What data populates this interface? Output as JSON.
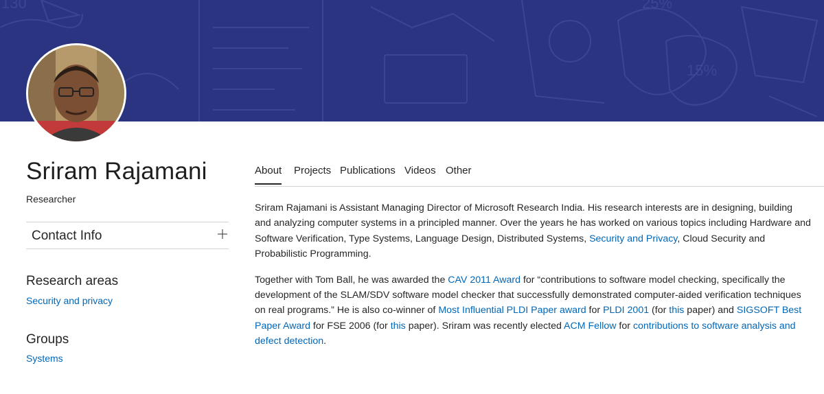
{
  "profile": {
    "name": "Sriram Rajamani",
    "role": "Researcher"
  },
  "contact": {
    "label": "Contact Info",
    "expand_icon": "plus-icon"
  },
  "research_areas": {
    "heading": "Research areas",
    "items": [
      "Security and privacy"
    ]
  },
  "groups": {
    "heading": "Groups",
    "items": [
      "Systems"
    ]
  },
  "tabs": [
    {
      "label": "About",
      "active": true
    },
    {
      "label": "Projects",
      "active": false
    },
    {
      "label": "Publications",
      "active": false
    },
    {
      "label": "Videos",
      "active": false
    },
    {
      "label": "Other",
      "active": false
    }
  ],
  "about": {
    "p1": {
      "t1": "Sriram Rajamani is Assistant Managing Director of Microsoft Research India. His research interests are in designing, building and analyzing computer systems in a principled manner. Over the years he has worked on various topics including Hardware and Software Verification, Type Systems, Language Design, Distributed Systems, ",
      "link1": "Security and Privacy",
      "t2": ", Cloud Security and Probabilistic Programming."
    },
    "p2": {
      "t1": "Together with Tom Ball, he was awarded the ",
      "link1": "CAV 2011 Award",
      "t2": " for “contributions to software model checking, specifically the development of the SLAM/SDV software model checker that successfully demonstrated computer-aided verification techniques on real programs.”  He is also co-winner of ",
      "link2": "Most Influential PLDI Paper award",
      "t3": " for ",
      "link3": "PLDI 2001",
      "t4": " (for ",
      "link4": "this",
      "t5": " paper) and ",
      "link5": "SIGSOFT Best Paper Award",
      "t6": " for FSE 2006 (for ",
      "link6": "this",
      "t7": " paper).  Sriram was recently elected ",
      "link7": "ACM Fellow",
      "t8": "  for ",
      "link8": "contributions to software analysis and defect detection",
      "t9": "."
    }
  },
  "banner_sketch_labels": [
    "130",
    "25%",
    "15%"
  ],
  "colors": {
    "banner": "#2b3481",
    "link": "#0067b8",
    "text": "#262626"
  }
}
